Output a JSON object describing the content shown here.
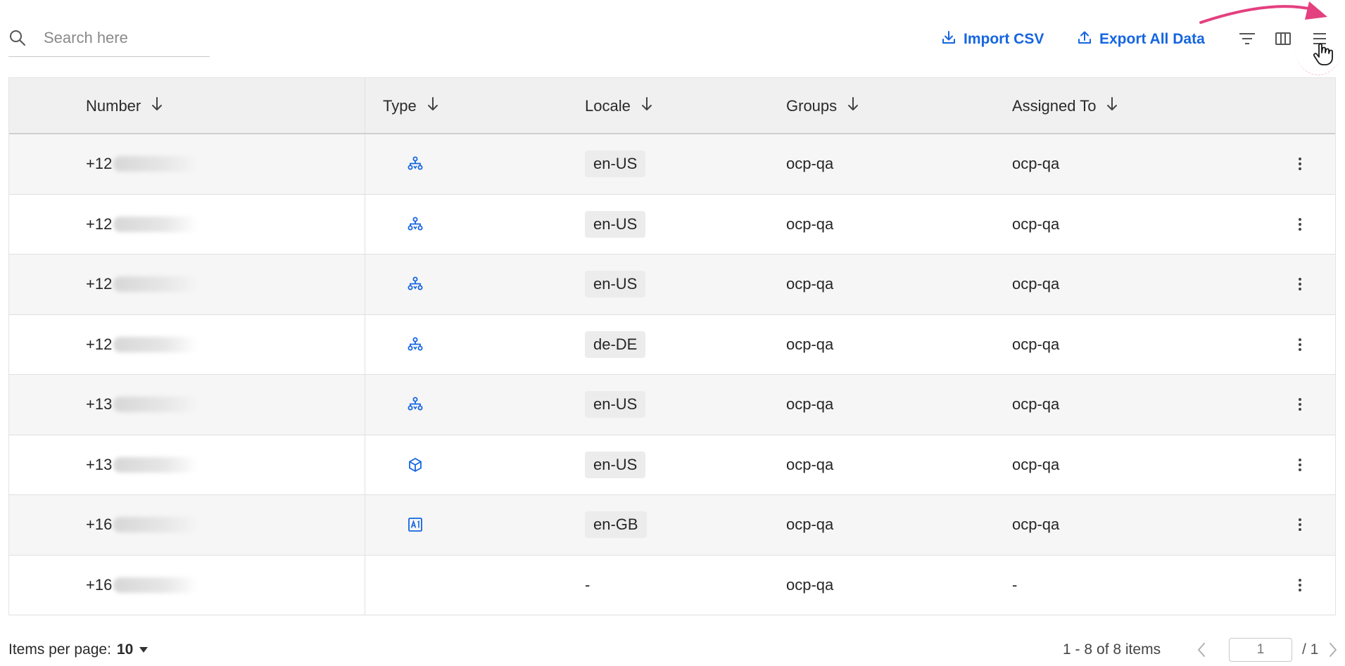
{
  "search": {
    "placeholder": "Search here"
  },
  "toolbar": {
    "import_label": "Import CSV",
    "export_label": "Export All Data"
  },
  "colors": {
    "accent": "#1565e0",
    "annotation": "#e4407f"
  },
  "table": {
    "columns": [
      "Number",
      "Type",
      "Locale",
      "Groups",
      "Assigned To"
    ],
    "rows": [
      {
        "number": "+12",
        "type_icon": "hierarchy-icon",
        "locale": "en-US",
        "groups": "ocp-qa",
        "assigned": "ocp-qa"
      },
      {
        "number": "+12",
        "type_icon": "hierarchy-icon",
        "locale": "en-US",
        "groups": "ocp-qa",
        "assigned": "ocp-qa"
      },
      {
        "number": "+12",
        "type_icon": "hierarchy-icon",
        "locale": "en-US",
        "groups": "ocp-qa",
        "assigned": "ocp-qa"
      },
      {
        "number": "+12",
        "type_icon": "hierarchy-icon",
        "locale": "de-DE",
        "groups": "ocp-qa",
        "assigned": "ocp-qa"
      },
      {
        "number": "+13",
        "type_icon": "hierarchy-icon",
        "locale": "en-US",
        "groups": "ocp-qa",
        "assigned": "ocp-qa"
      },
      {
        "number": "+13",
        "type_icon": "cube-icon",
        "locale": "en-US",
        "groups": "ocp-qa",
        "assigned": "ocp-qa"
      },
      {
        "number": "+16",
        "type_icon": "ai-icon",
        "locale": "en-GB",
        "groups": "ocp-qa",
        "assigned": "ocp-qa"
      },
      {
        "number": "+16",
        "type_icon": "",
        "locale": "-",
        "groups": "ocp-qa",
        "assigned": "-"
      }
    ]
  },
  "footer": {
    "items_per_page_label": "Items per page:",
    "items_per_page_value": "10",
    "range_text": "1 - 8",
    "of_items_text": "of 8 items",
    "page_value": "1",
    "page_total": "/ 1"
  }
}
